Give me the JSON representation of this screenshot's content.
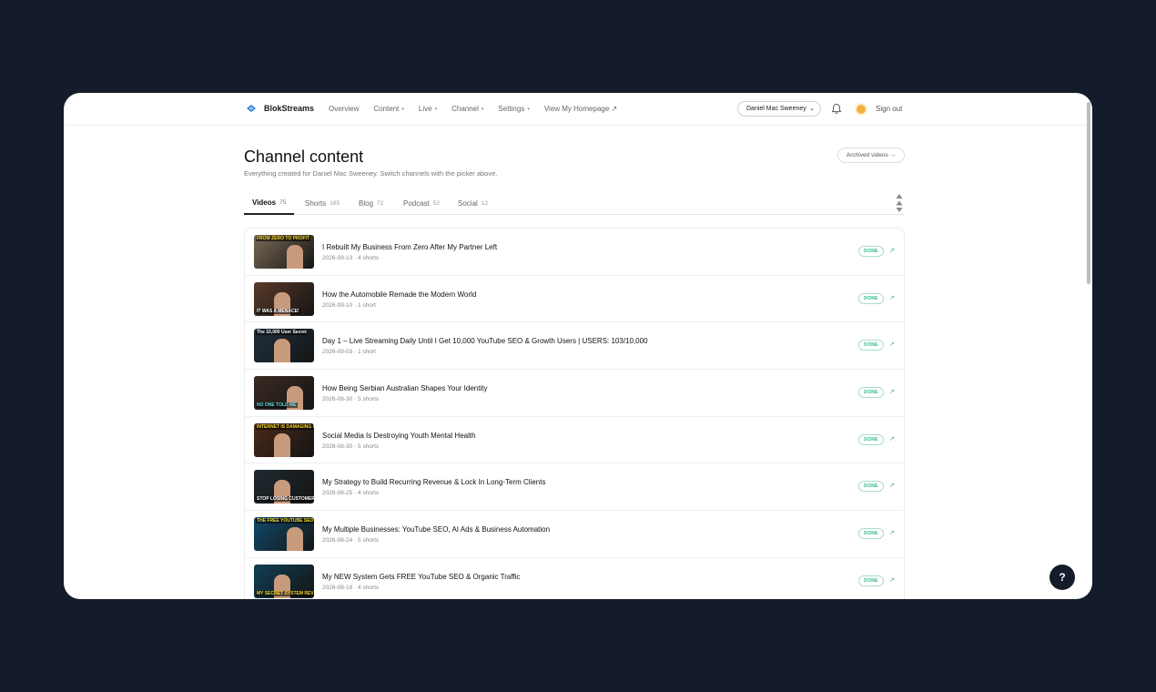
{
  "app": {
    "name": "BlokStreams",
    "accent": "#2f7be0"
  },
  "nav": {
    "items": [
      {
        "label": "Overview",
        "caret": ""
      },
      {
        "label": "Content",
        "caret": "▾"
      },
      {
        "label": "Live",
        "caret": "▾"
      },
      {
        "label": "Channel",
        "caret": "▾"
      },
      {
        "label": "Settings",
        "caret": "▾"
      },
      {
        "label": "View My Homepage ↗",
        "caret": ""
      }
    ],
    "channel_selected": "Daniel Mac Sweeney",
    "sign_out": "Sign out"
  },
  "page": {
    "title": "Channel content",
    "subtitle": "Everything created for Daniel Mac Sweeney. Switch channels with the picker above.",
    "archived_label": "Archived videos →"
  },
  "tabs": [
    {
      "label": "Videos",
      "count": "75"
    },
    {
      "label": "Shorts",
      "count": "165"
    },
    {
      "label": "Blog",
      "count": "72"
    },
    {
      "label": "Podcast",
      "count": "52"
    },
    {
      "label": "Social",
      "count": "12"
    }
  ],
  "videos": [
    {
      "title": "I Rebuilt My Business From Zero After My Partner Left",
      "meta": "2026-09-13 · 4 shorts",
      "status": "DONE",
      "thumb_caption": "FROM ZERO TO PROFIT",
      "thumb_bg": "#7a6a55",
      "caption_color": "#f5d628"
    },
    {
      "title": "How the Automobile Remade the Modern World",
      "meta": "2026-09-10 · 1 short",
      "status": "DONE",
      "thumb_caption": "IT WAS A MENACE!",
      "thumb_bg": "#5a3a2a",
      "caption_color": "#ffffff"
    },
    {
      "title": "Day 1 – Live Streaming Daily Until I Get 10,000 YouTube SEO & Growth Users | USERS: 103/10,000",
      "meta": "2026-09-03 · 1 short",
      "status": "DONE",
      "thumb_caption": "The 10,000 User Secret",
      "thumb_bg": "#1f2f3d",
      "caption_color": "#ffffff"
    },
    {
      "title": "How Being Serbian Australian Shapes Your Identity",
      "meta": "2026-08-30 · 5 shorts",
      "status": "DONE",
      "thumb_caption": "NO ONE TOLD ME",
      "thumb_bg": "#3a2a22",
      "caption_color": "#5fe0e0"
    },
    {
      "title": "Social Media Is Destroying Youth Mental Health",
      "meta": "2026-08-30 · 5 shorts",
      "status": "DONE",
      "thumb_caption": "INTERNET IS DAMAGING KIDS",
      "thumb_bg": "#4a2a1a",
      "caption_color": "#f5d628"
    },
    {
      "title": "My Strategy to Build Recurring Revenue & Lock In Long-Term Clients",
      "meta": "2026-08-25 · 4 shorts",
      "status": "DONE",
      "thumb_caption": "STOP LOSING CUSTOMERS!",
      "thumb_bg": "#1f2a30",
      "caption_color": "#ffffff"
    },
    {
      "title": "My Multiple Businesses: YouTube SEO, AI Ads & Business Automation",
      "meta": "2026-08-24 · 5 shorts",
      "status": "DONE",
      "thumb_caption": "THE FREE YOUTUBE SEO?",
      "thumb_bg": "#0f4a6a",
      "caption_color": "#f5d628"
    },
    {
      "title": "My NEW System Gets FREE YouTube SEO & Organic Traffic",
      "meta": "2026-08-18 · 4 shorts",
      "status": "DONE",
      "thumb_caption": "MY SECRET SYSTEM REVEALED",
      "thumb_bg": "#0f3f55",
      "caption_color": "#f5d628"
    }
  ],
  "help_label": "?"
}
